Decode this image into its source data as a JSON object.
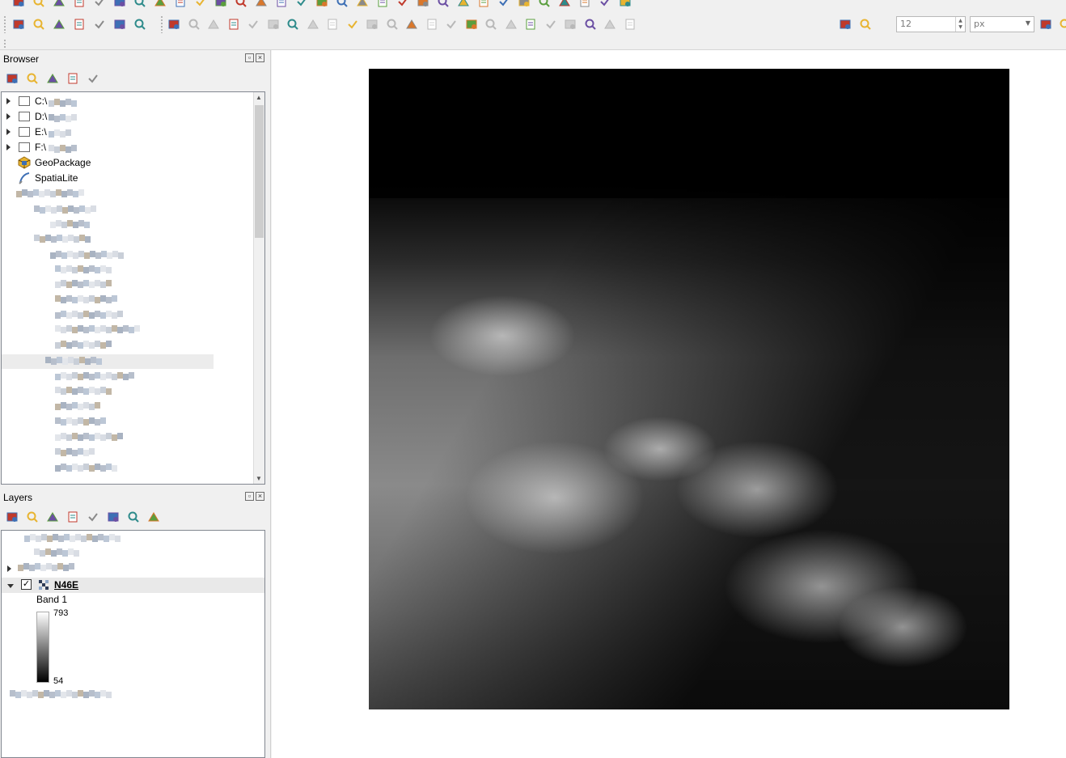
{
  "toolbar": {
    "font_size_value": "12",
    "font_unit": "px",
    "icons_row1": [
      "new-project-icon",
      "open-project-icon",
      "save-project-icon",
      "save-as-icon",
      "print-layout-icon",
      "layout-manager-icon",
      "pan-icon",
      "pan-to-selection-icon",
      "zoom-in-icon",
      "zoom-out-icon",
      "zoom-full-icon",
      "zoom-selection-icon",
      "zoom-layer-icon",
      "zoom-native-icon",
      "zoom-last-icon",
      "zoom-next-icon",
      "new-bookmark-icon",
      "show-bookmarks-icon",
      "temporal-icon",
      "refresh-icon",
      "identify-icon",
      "select-icon",
      "deselect-icon",
      "attribute-table-icon",
      "field-calculator-icon",
      "statistics-icon",
      "measure-icon",
      "annotation-icon",
      "map-tips-icon",
      "python-icon",
      "plugins-icon"
    ],
    "icons_row2": [
      "add-vector-layer-icon",
      "add-raster-layer-icon",
      "add-delimited-text-icon",
      "add-spatialite-icon",
      "add-virtual-layer-icon",
      "add-wms-icon",
      "add-wfs-icon",
      "current-edits-icon",
      "toggle-editing-icon",
      "save-edits-icon",
      "digitize-icon",
      "vertex-tool-icon",
      "delete-selected-icon",
      "cut-features-icon",
      "copy-features-icon",
      "paste-features-icon",
      "undo-icon",
      "redo-icon",
      "add-ring-icon",
      "add-part-icon",
      "fill-ring-icon",
      "delete-ring-icon",
      "delete-part-icon",
      "reshape-icon",
      "offset-curve-icon",
      "split-features-icon",
      "split-parts-icon",
      "merge-features-icon",
      "merge-attributes-icon",
      "rotate-point-symbols-icon",
      "offset-point-symbols-icon",
      "snapping-magnet-icon",
      "tracing-icon",
      "font-size-spinbox",
      "font-unit-select",
      "label-pin-icon",
      "label-show-icon"
    ]
  },
  "browser": {
    "title": "Browser",
    "toolbar_icons": [
      "add-selected-layers-icon",
      "refresh-icon",
      "filter-browser-icon",
      "collapse-all-icon",
      "properties-info-icon"
    ],
    "items": [
      {
        "label": "C:\\",
        "icon": "drive-folder-icon",
        "expandable": true
      },
      {
        "label": "D:\\",
        "icon": "drive-folder-icon",
        "expandable": true
      },
      {
        "label": "E:\\",
        "icon": "drive-folder-icon",
        "expandable": true
      },
      {
        "label": "F:\\",
        "icon": "drive-folder-icon",
        "expandable": true
      },
      {
        "label": "GeoPackage",
        "icon": "geopackage-icon",
        "expandable": false
      },
      {
        "label": "SpatiaLite",
        "icon": "spatialite-icon",
        "expandable": false
      }
    ]
  },
  "layers": {
    "title": "Layers",
    "toolbar_icons": [
      "open-styling-panel-icon",
      "add-group-icon",
      "manage-visibility-icon",
      "filter-legend-icon",
      "filter-by-expression-icon",
      "expand-all-icon",
      "collapse-all-icon",
      "remove-layer-icon"
    ],
    "active_layer": {
      "name": "N46E",
      "checked": true,
      "expanded": true
    },
    "band_label": "Band 1",
    "ramp_max": "793",
    "ramp_min": "54"
  },
  "colors": {
    "panel_bg": "#f0f0f0",
    "tree_bg": "#ffffff",
    "canvas_bg": "#ffffff",
    "dem_low": "#000000",
    "dem_high": "#ffffff"
  }
}
